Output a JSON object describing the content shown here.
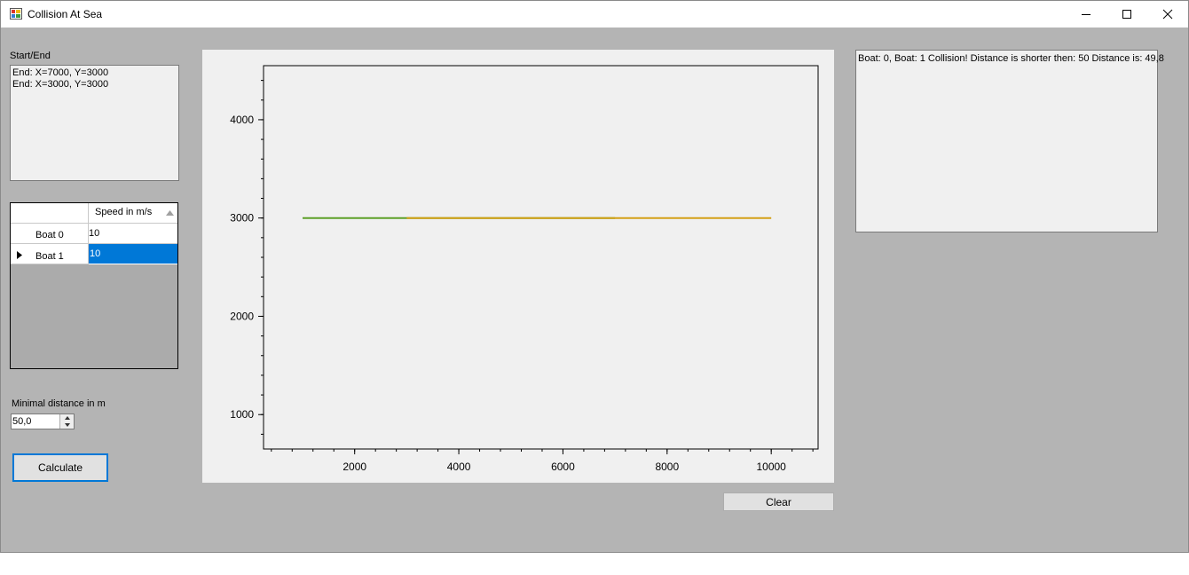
{
  "window": {
    "title": "Collision At Sea",
    "icon": "app-form-icon"
  },
  "start_end": {
    "label": "Start/End",
    "lines": [
      "End: X=7000, Y=3000",
      "End: X=3000, Y=3000"
    ]
  },
  "speed_grid": {
    "header": "Speed in m/s",
    "rows": [
      {
        "name": "Boat 0",
        "speed": "10"
      },
      {
        "name": "Boat 1",
        "speed": "10"
      }
    ]
  },
  "min_distance": {
    "label": "Minimal distance in m",
    "value": "50,0"
  },
  "buttons": {
    "calculate": "Calculate",
    "clear": "Clear"
  },
  "log": {
    "text": "Boat: 0, Boat: 1 Collision! Distance is shorter then: 50 Distance is: 49,8"
  },
  "colors": {
    "selection": "#0078d7",
    "boat0_line": "#5da028",
    "boat1_line": "#d4a017"
  },
  "chart_data": {
    "type": "line",
    "title": "",
    "xlabel": "",
    "ylabel": "",
    "xlim": [
      250,
      10900
    ],
    "ylim": [
      650,
      4550
    ],
    "xticks": [
      2000,
      4000,
      6000,
      8000,
      10000
    ],
    "yticks": [
      1000,
      2000,
      3000,
      4000
    ],
    "grid": false,
    "series": [
      {
        "color": "#5da028",
        "points": [
          [
            1000,
            3000
          ],
          [
            7000,
            3000
          ]
        ]
      },
      {
        "color": "#d4a017",
        "points": [
          [
            3000,
            3000
          ],
          [
            10000,
            3000
          ]
        ]
      }
    ]
  }
}
